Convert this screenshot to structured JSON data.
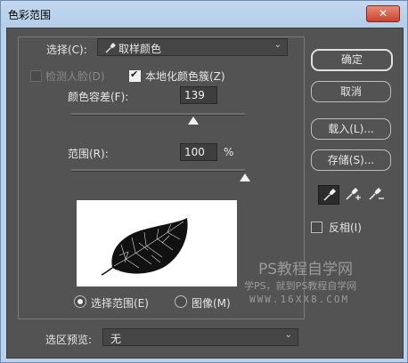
{
  "window": {
    "title": "色彩范围",
    "close_glyph": "✕"
  },
  "select": {
    "label": "选择(C):",
    "icon": "eyedropper-icon",
    "value": "取样颜色"
  },
  "checks": {
    "detect_faces": "检测人脸(D)",
    "localized": "本地化颜色簇(Z)"
  },
  "fuzziness": {
    "label": "颜色容差(F):",
    "value": "139",
    "level_fraction": 0.7
  },
  "range": {
    "label": "范围(R):",
    "value": "100",
    "unit": "%",
    "level_fraction": 1.0
  },
  "radios": {
    "selection": "选择范围(E)",
    "image": "图像(M)"
  },
  "preview": {
    "label": "选区预览:",
    "value": "无"
  },
  "buttons": {
    "ok": "确定",
    "cancel": "取消",
    "load": "载入(L)...",
    "save": "存储(S)..."
  },
  "tools": [
    "eyedropper-icon",
    "eyedropper-plus-icon",
    "eyedropper-minus-icon"
  ],
  "invert": "反相(I)",
  "watermark": {
    "line1": "PS教程自学网",
    "line2": "学PS，就到PS教程自学网",
    "line3": "WWW.16XX8.COM"
  }
}
